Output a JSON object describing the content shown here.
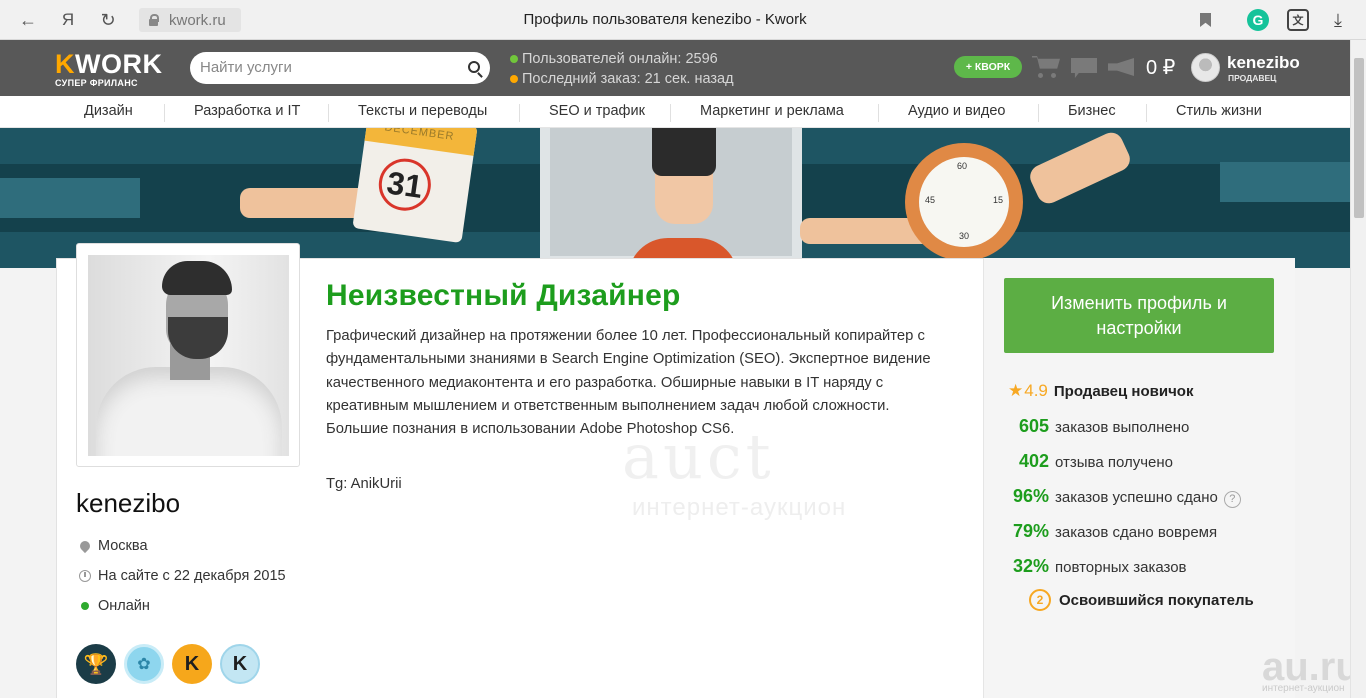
{
  "browser": {
    "url": "kwork.ru",
    "tab_title": "Профиль пользователя kenezibo - Kwork",
    "back_glyph": "←",
    "yandex_glyph": "Я",
    "reload_glyph": "↻",
    "grammarly_glyph": "G",
    "translate_glyph": "文",
    "download_glyph": "⤓"
  },
  "header": {
    "logo_k": "K",
    "logo_rest": "WORK",
    "logo_sub": "СУПЕР ФРИЛАНС",
    "search_placeholder": "Найти услуги",
    "users_online": "Пользователей онлайн: 2596",
    "last_order": "Последний заказ: 21 сек. назад",
    "kwork_button": "+ КВОРК",
    "balance": "0 ₽",
    "user_name": "kenezibo",
    "user_role": "ПРОДАВЕЦ"
  },
  "categories": [
    "Дизайн",
    "Разработка и IT",
    "Тексты и переводы",
    "SEO и трафик",
    "Маркетинг и реклама",
    "Аудио и видео",
    "Бизнес",
    "Стиль жизни"
  ],
  "banner": {
    "calendar_month": "DECEMBER",
    "calendar_day": "31",
    "watch_numbers": [
      "60",
      "15",
      "30",
      "45"
    ]
  },
  "profile": {
    "username": "kenezibo",
    "location": "Москва",
    "since": "На сайте с 22 декабря 2015",
    "status": "Онлайн",
    "title": "Неизвестный Дизайнер",
    "description": "Графический дизайнер на протяжении более 10 лет. Профессиональный копирайтер с фундаментальными знаниями в Search Engine Optimization (SEO). Экспертное видение качественного медиаконтента и его разработка. Обширные навыки в IT наряду с креативным мышлением и ответственным выполнением задач любой сложности. Большие познания в использовании Adobe Photoshop CS6.",
    "telegram": "Tg: AnikUrii",
    "badges": [
      "🏆",
      "✿",
      "K",
      "K"
    ]
  },
  "sidebar": {
    "edit_button": "Изменить профиль и настройки",
    "rating_value": "4.9",
    "rating_label": "Продавец новичок",
    "stats": [
      {
        "value": "605",
        "label": "заказов выполнено"
      },
      {
        "value": "402",
        "label": "отзыва получено"
      },
      {
        "value": "96%",
        "label": "заказов успешно сдано"
      },
      {
        "value": "79%",
        "label": "заказов сдано вовремя"
      },
      {
        "value": "32%",
        "label": "повторных заказов"
      }
    ],
    "help_glyph": "?",
    "buyer_level": "2",
    "buyer_label": "Освоившийся покупатель"
  },
  "watermark": {
    "big": "auct",
    "sub": "интернет-аукцион",
    "site": "au.ru",
    "site_sub": "интернет-аукцион"
  },
  "colors": {
    "accent_green": "#1d9d1d",
    "button_green": "#5cae44",
    "header_bg": "#585858",
    "banner_bg": "#1e5563",
    "star": "#f7a823",
    "logo_orange": "#ffa800"
  }
}
